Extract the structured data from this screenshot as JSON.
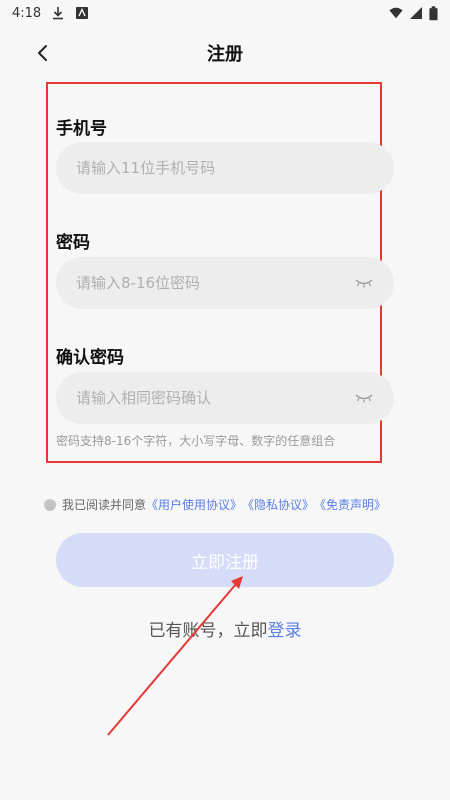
{
  "status_bar": {
    "time": "4:18",
    "icons": [
      "download-icon",
      "app-notification-icon",
      "wifi-icon",
      "signal-icon",
      "battery-icon"
    ]
  },
  "header": {
    "title": "注册",
    "back_icon": "chevron-left-icon"
  },
  "form": {
    "phone": {
      "label": "手机号",
      "placeholder": "请输入11位手机号码",
      "value": ""
    },
    "password": {
      "label": "密码",
      "placeholder": "请输入8-16位密码",
      "value": "",
      "toggle_icon": "eye-closed-icon"
    },
    "confirm": {
      "label": "确认密码",
      "placeholder": "请输入相同密码确认",
      "value": "",
      "toggle_icon": "eye-closed-icon"
    },
    "hint": "密码支持8-16个字符，大小写字母、数字的任意组合"
  },
  "agreement": {
    "prefix": "我已阅读并同意",
    "user_agreement": "《用户使用协议》",
    "privacy": "《隐私协议》",
    "disclaimer": "《免责声明》"
  },
  "submit_label": "立即注册",
  "login": {
    "prefix": "已有账号，立即",
    "link": "登录"
  },
  "colors": {
    "accent": "#5b7de6",
    "submit_disabled": "#d6dbf8",
    "annotation_red": "#e53935"
  }
}
